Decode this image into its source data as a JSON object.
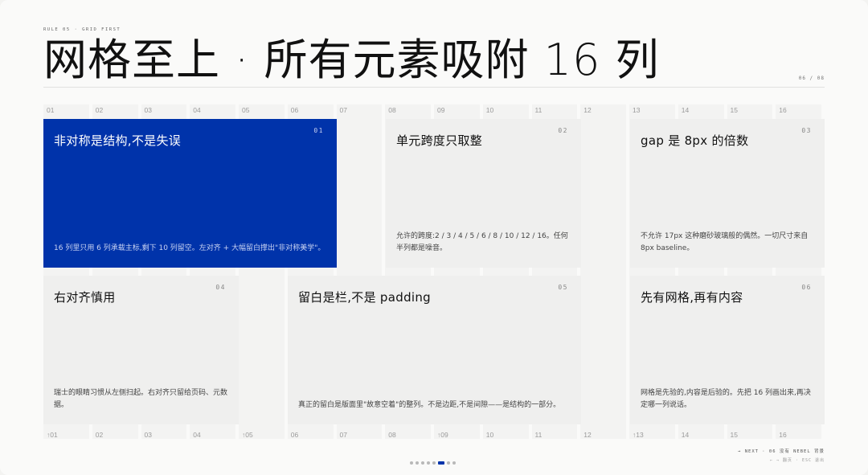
{
  "header": {
    "rule_label": "RULE 05 · GRID FIRST",
    "title": "网格至上 · 所有元素吸附 16 列",
    "page_counter": "06 / 08"
  },
  "grid": {
    "top_labels": [
      "01",
      "02",
      "03",
      "04",
      "05",
      "06",
      "07",
      "08",
      "09",
      "10",
      "11",
      "12",
      "13",
      "14",
      "15",
      "16"
    ],
    "bottom_labels": [
      "↑01",
      "02",
      "03",
      "04",
      "↑05",
      "06",
      "07",
      "08",
      "↑09",
      "10",
      "11",
      "12",
      "↑13",
      "14",
      "15",
      "16"
    ]
  },
  "cards": [
    {
      "num": "01",
      "title": "非对称是结构,不是失误",
      "body": "16 列里只用 6 列承载主标,剩下 10 列留空。左对齐 + 大幅留白撑出\"非对称美学\"。",
      "highlight": true
    },
    {
      "num": "02",
      "title": "单元跨度只取整",
      "body": "允许的跨度:2 / 3 / 4 / 5 / 6 / 8 / 10 / 12 / 16。任何半列都是噪音。"
    },
    {
      "num": "03",
      "title": "gap 是 8px 的倍数",
      "body": "不允许 17px 这种磨砂玻璃般的偶然。一切尺寸来自 8px baseline。"
    },
    {
      "num": "04",
      "title": "右对齐慎用",
      "body": "瑞士的眼睛习惯从左侧扫起。右对齐只留给页码、元数据。"
    },
    {
      "num": "05",
      "title": "留白是栏,不是 padding",
      "body": "真正的留白是版面里\"故意空着\"的整列。不是边距,不是间隙——是结构的一部分。"
    },
    {
      "num": "06",
      "title": "先有网格,再有内容",
      "body": "网格是先验的,内容是后验的。先把 16 列画出来,再决定哪一列说话。"
    }
  ],
  "footer": {
    "next": "→ NEXT · 06 没有 NEBEL 背景",
    "hint": "← → 翻页 · ESC 退出"
  },
  "pager": {
    "total": 8,
    "current": 6
  },
  "colors": {
    "accent": "#0033aa",
    "card": "#efefee",
    "background": "#fafaf9"
  }
}
